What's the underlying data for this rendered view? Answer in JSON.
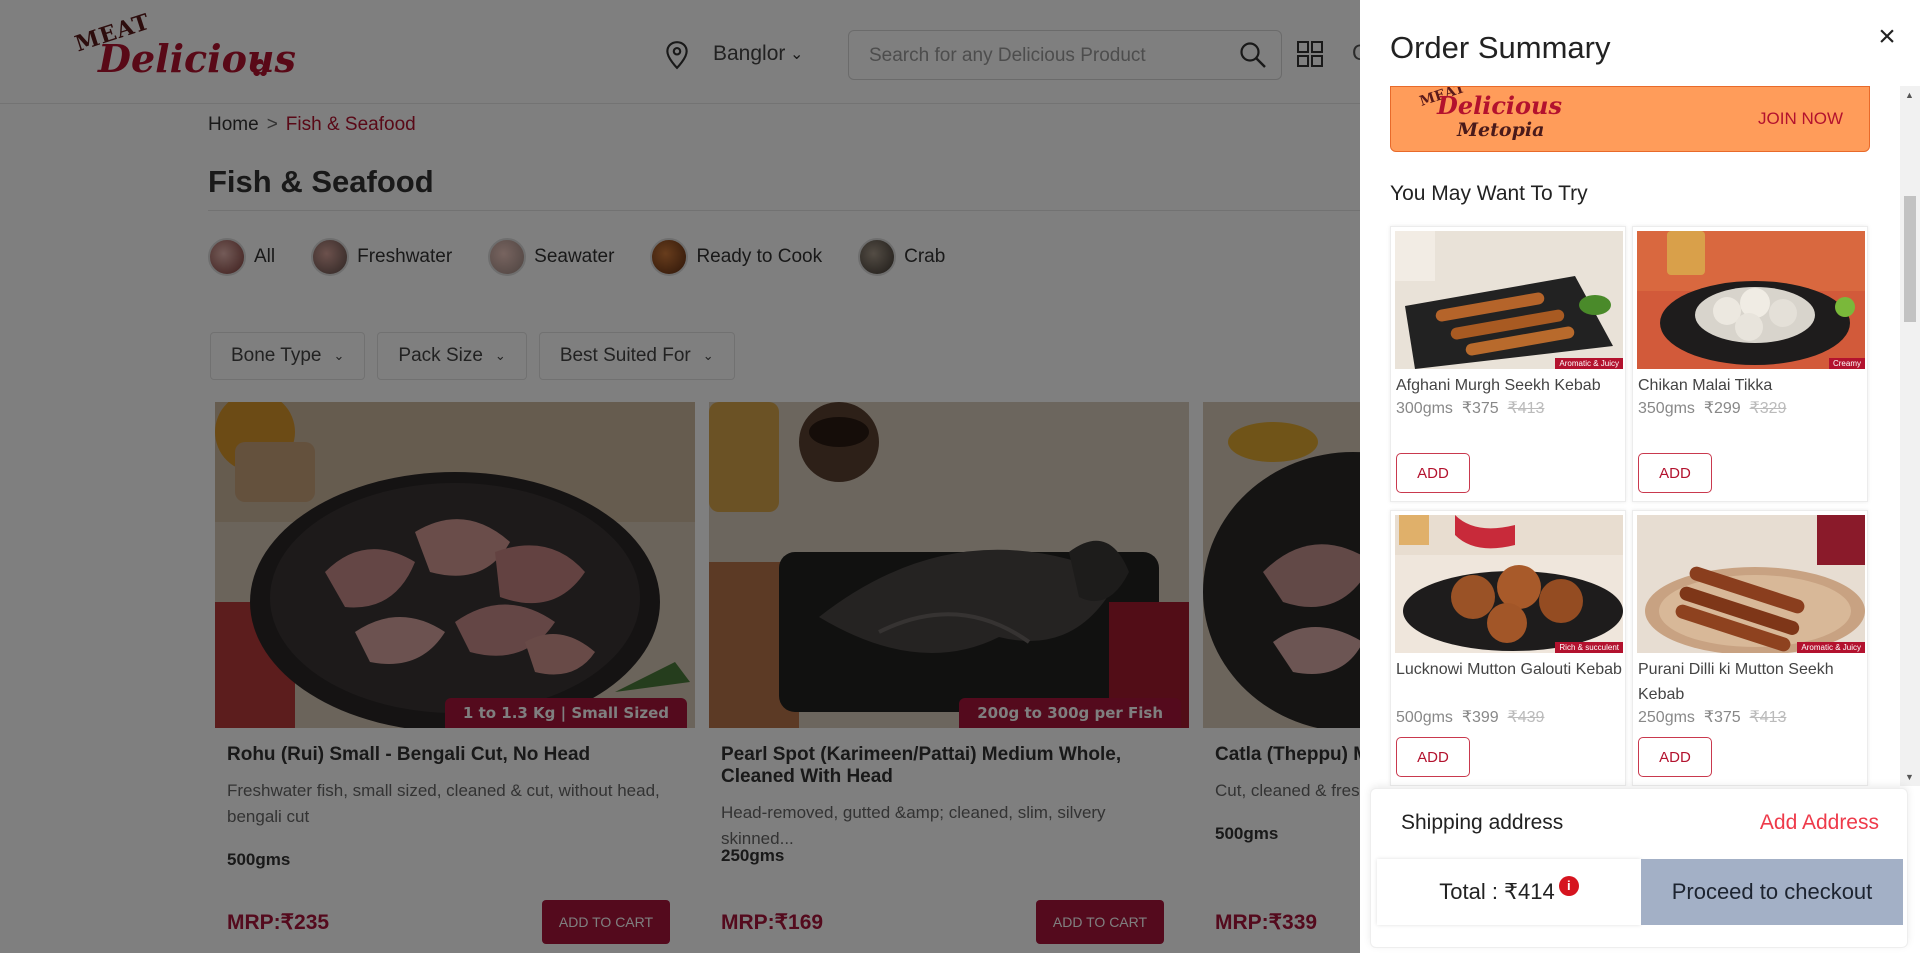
{
  "header": {
    "logo_top": "MEAT",
    "logo_main": "Delicious",
    "location": "Banglore",
    "search_placeholder": "Search for any Delicious Product",
    "cut_letter": "C"
  },
  "breadcrumb": {
    "home": "Home",
    "separator": ">",
    "current": "Fish & Seafood"
  },
  "page_title": "Fish & Seafood",
  "categories": [
    "All",
    "Freshwater",
    "Seawater",
    "Ready to Cook",
    "Crab"
  ],
  "filters": [
    "Bone Type",
    "Pack Size",
    "Best Suited For"
  ],
  "products": [
    {
      "tag": "1 to 1.3 Kg | Small Sized",
      "name": "Rohu (Rui) Small - Bengali Cut, No Head",
      "desc": "Freshwater fish, small sized, cleaned & cut, without head, bengali cut",
      "weight": "500gms",
      "mrp": "MRP:₹235",
      "button": "ADD TO CART"
    },
    {
      "tag": "200g to 300g per Fish",
      "name": "Pearl Spot (Karimeen/Pattai) Medium Whole, Cleaned With Head",
      "desc": "Head-removed, gutted &amp; cleaned, slim, silvery skinned...",
      "weight": "250gms",
      "mrp": "MRP:₹169",
      "button": "ADD TO CART"
    },
    {
      "tag": "",
      "name": "Catla (Theppu) M",
      "desc": "Cut, cleaned & fresh",
      "weight": "500gms",
      "mrp": "MRP:₹339",
      "button": ""
    }
  ],
  "drawer": {
    "title": "Order Summary",
    "close": "×",
    "banner": {
      "logo_top": "MEAT",
      "logo_main": "Delicious",
      "logo_sub": "Metopia",
      "cta": "JOIN NOW"
    },
    "try_title": "You May Want To Try",
    "suggestions": [
      {
        "name": "Afghani Murgh Seekh Kebab",
        "weight": "300gms",
        "price": "₹375",
        "mrp": "₹413",
        "badge": "Aromatic & Juicy",
        "button": "ADD"
      },
      {
        "name": "Chikan Malai Tikka",
        "weight": "350gms",
        "price": "₹299",
        "mrp": "₹329",
        "badge": "Creamy",
        "button": "ADD"
      },
      {
        "name": "Lucknowi Mutton Galouti Kebab",
        "weight": "500gms",
        "price": "₹399",
        "mrp": "₹439",
        "badge": "Rich & succulent",
        "button": "ADD"
      },
      {
        "name": "Purani Dilli ki Mutton Seekh Kebab",
        "weight": "250gms",
        "price": "₹375",
        "mrp": "₹413",
        "badge": "Aromatic & Juicy",
        "button": "ADD"
      }
    ],
    "shipping_label": "Shipping address",
    "add_address": "Add Address",
    "total_label": "Total : ₹414",
    "info_glyph": "i",
    "checkout": "Proceed to checkout"
  },
  "colors": {
    "brand": "#a8143a",
    "accent_red": "#ee3a4a",
    "banner": "#ff9c5a",
    "checkout": "#a3b0c6"
  }
}
